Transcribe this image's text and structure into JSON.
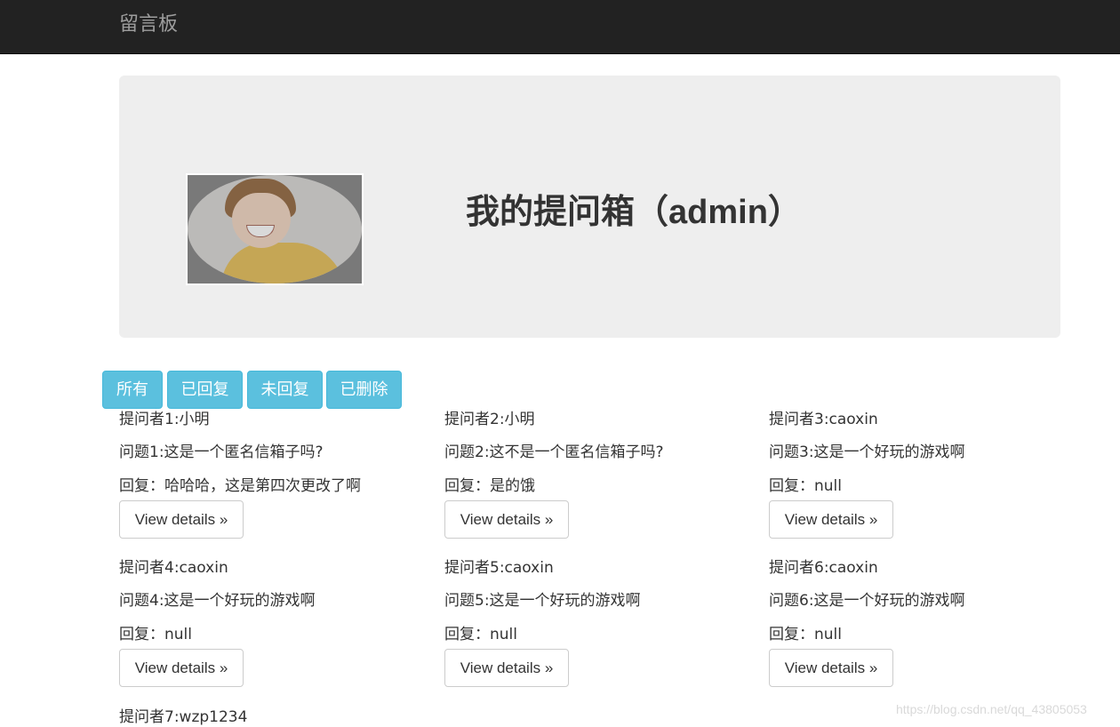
{
  "navbar": {
    "brand": "留言板"
  },
  "jumbotron": {
    "title": "我的提问箱（admin）"
  },
  "filters": [
    {
      "label": "所有"
    },
    {
      "label": "已回复"
    },
    {
      "label": "未回复"
    },
    {
      "label": "已删除"
    }
  ],
  "cards": [
    {
      "asker": "提问者1:小明",
      "question": "问题1:这是一个匿名信箱子吗?",
      "reply": "回复：哈哈哈，这是第四次更改了啊",
      "button": "View details »"
    },
    {
      "asker": "提问者2:小明",
      "question": "问题2:这不是一个匿名信箱子吗?",
      "reply": "回复：是的饿",
      "button": "View details »"
    },
    {
      "asker": "提问者3:caoxin",
      "question": "问题3:这是一个好玩的游戏啊",
      "reply": "回复：null",
      "button": "View details »"
    },
    {
      "asker": "提问者4:caoxin",
      "question": "问题4:这是一个好玩的游戏啊",
      "reply": "回复：null",
      "button": "View details »"
    },
    {
      "asker": "提问者5:caoxin",
      "question": "问题5:这是一个好玩的游戏啊",
      "reply": "回复：null",
      "button": "View details »"
    },
    {
      "asker": "提问者6:caoxin",
      "question": "问题6:这是一个好玩的游戏啊",
      "reply": "回复：null",
      "button": "View details »"
    },
    {
      "asker": "提问者7:wzp1234"
    }
  ],
  "watermark": "https://blog.csdn.net/qq_43805053"
}
